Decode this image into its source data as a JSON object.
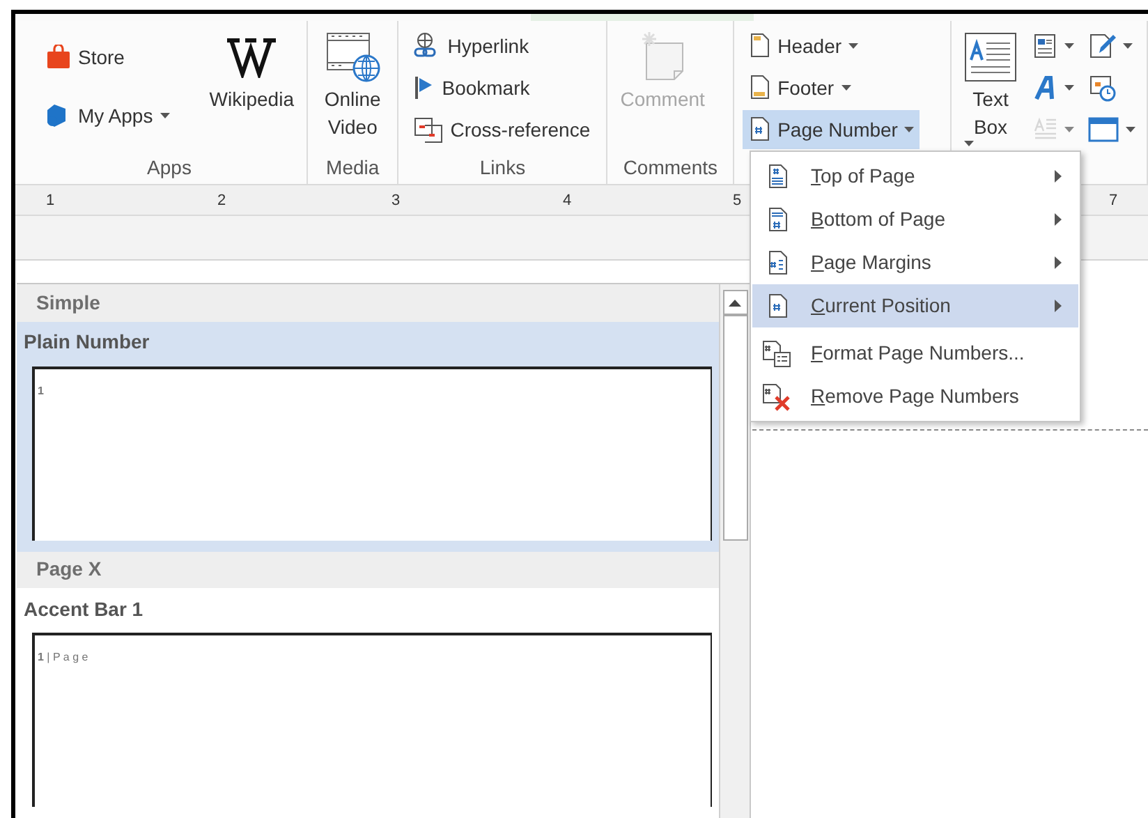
{
  "ribbon": {
    "groups": [
      {
        "label": "Apps",
        "columns": [
          [
            {
              "kind": "small",
              "label": "Store",
              "has_menu": false
            },
            {
              "kind": "small",
              "label": "My Apps",
              "has_menu": true
            }
          ],
          [
            {
              "kind": "large",
              "label": "Wikipedia",
              "has_menu": false
            }
          ]
        ]
      },
      {
        "label": "Media",
        "columns": [
          [
            {
              "kind": "large",
              "label": "Online Video",
              "has_menu": false
            }
          ]
        ]
      },
      {
        "label": "Links",
        "columns": [
          [
            {
              "kind": "small",
              "label": "Hyperlink",
              "has_menu": false
            },
            {
              "kind": "small",
              "label": "Bookmark",
              "has_menu": false
            },
            {
              "kind": "small",
              "label": "Cross-reference",
              "has_menu": false
            }
          ]
        ]
      },
      {
        "label": "Comments",
        "columns": [
          [
            {
              "kind": "large",
              "label": "Comment",
              "has_menu": false,
              "disabled": true
            }
          ]
        ]
      },
      {
        "columns": [
          [
            {
              "kind": "small",
              "label": "Header",
              "has_menu": true,
              "expanded": false
            },
            {
              "kind": "small",
              "label": "Footer",
              "has_menu": true,
              "expanded": false
            },
            {
              "kind": "small",
              "label": "Page Number",
              "has_menu": true,
              "expanded": true
            }
          ]
        ]
      },
      {
        "columns": [
          [
            {
              "kind": "large",
              "label": "Text Box",
              "has_menu": true
            }
          ],
          [
            {
              "kind": "icon",
              "has_menu": true
            },
            {
              "kind": "icon",
              "has_menu": true
            },
            {
              "kind": "icon",
              "has_menu": true,
              "disabled": true
            }
          ],
          [
            {
              "kind": "icon",
              "has_menu": true
            },
            {
              "kind": "icon",
              "has_menu": false
            },
            {
              "kind": "icon",
              "has_menu": true
            }
          ]
        ]
      }
    ]
  },
  "ruler": [
    "1",
    "2",
    "3",
    "4",
    "5",
    "7"
  ],
  "gallery": {
    "sections": [
      {
        "heading": "Simple",
        "items": [
          {
            "title": "Plain Number",
            "selected": true,
            "preview": "**1**"
          }
        ]
      },
      {
        "heading": "Page X",
        "items": [
          {
            "title": "Accent Bar 1",
            "selected": false,
            "preview": "**1** | P a g e"
          }
        ]
      }
    ]
  },
  "menu": {
    "items": [
      {
        "label": "Top of Page",
        "has_submenu": true,
        "selected": false
      },
      {
        "label": "Bottom of Page",
        "has_submenu": true,
        "selected": false
      },
      {
        "label": "Page Margins",
        "has_submenu": true,
        "selected": false
      },
      {
        "label": "Current Position",
        "has_submenu": true,
        "selected": true
      },
      {
        "label": "Format Page Numbers...",
        "has_submenu": false,
        "selected": false
      },
      {
        "label": "Remove Page Numbers",
        "has_submenu": false,
        "selected": false
      }
    ]
  }
}
